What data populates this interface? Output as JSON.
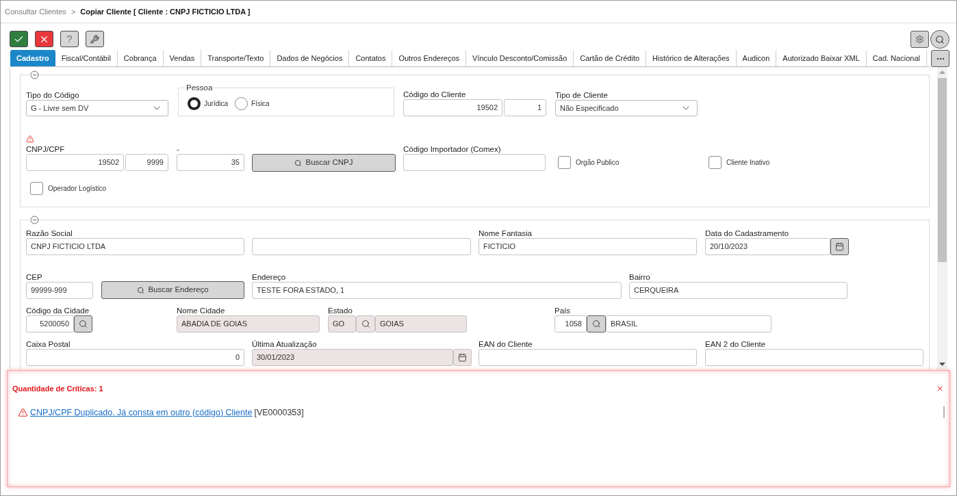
{
  "breadcrumb": {
    "parent": "Consultar Clientes",
    "separator": ">",
    "current": "Copiar Cliente [ Cliente : CNPJ FICTICIO LTDA ]"
  },
  "toolbar": {
    "actions": [
      {
        "kind": "confirm"
      },
      {
        "kind": "cancel"
      },
      {
        "kind": "help",
        "label": "?"
      },
      {
        "kind": "tools"
      }
    ],
    "tools": [
      {
        "kind": "settings"
      },
      {
        "kind": "search"
      }
    ]
  },
  "tabs": [
    {
      "label": "Cadastro",
      "selected": true
    },
    {
      "label": "Fiscal/Contábil",
      "selected": false
    },
    {
      "label": "Cobrança",
      "selected": false
    },
    {
      "label": "Vendas",
      "selected": false
    },
    {
      "label": "Transporte/Texto",
      "selected": false
    },
    {
      "label": "Dados de Negócios",
      "selected": false
    },
    {
      "label": "Contatos",
      "selected": false
    },
    {
      "label": "Outros Endereços",
      "selected": false
    },
    {
      "label": "Vínculo Desconto/Comissão",
      "selected": false
    },
    {
      "label": "Cartão de Crédito",
      "selected": false
    },
    {
      "label": "Histórico de Alterações",
      "selected": false
    },
    {
      "label": "Audicon",
      "selected": false
    },
    {
      "label": "Autorizado Baixar XML",
      "selected": false
    },
    {
      "label": "Cad. Nacional",
      "selected": false
    }
  ],
  "identification": {
    "expanded": true,
    "code_type": {
      "label": "Tipo do Código",
      "value": "G - Livre sem DV"
    },
    "person": {
      "legend": "Pessoa",
      "options": [
        {
          "label": "Jurídica",
          "selected": true
        },
        {
          "label": "Física",
          "selected": false
        }
      ]
    },
    "client_code": {
      "label": "Código do Cliente",
      "values": [
        "19502",
        "1"
      ]
    },
    "client_type": {
      "label": "Tipo de Cliente",
      "value": "Não Especificado"
    },
    "cnpj_cpf": {
      "label": "CNPJ/CPF",
      "warning": true,
      "values": [
        "19502",
        "9999"
      ]
    },
    "check_digit": {
      "label": "-",
      "value": "35"
    },
    "search_cnpj": {
      "label": "Buscar CNPJ"
    },
    "importer_code": {
      "label": "Código Importador (Comex)"
    },
    "flags": [
      {
        "label": "Orgão Publico",
        "checked": false
      },
      {
        "label": "Cliente Inativo",
        "checked": false
      }
    ],
    "logistics_operator": {
      "label": "Operador Logístico",
      "checked": false
    }
  },
  "address": {
    "expanded": true,
    "company_name": {
      "label": "Razão Social",
      "value": "CNPJ FICTICIO LTDA"
    },
    "trade_name": {
      "label": "Nome Fantasia",
      "value": "FICTICIO"
    },
    "registration_date": {
      "label": "Data do Cadastramento",
      "value": "20/10/2023"
    },
    "cep": {
      "label": "CEP",
      "value": "99999-999"
    },
    "search_address": {
      "label": "Buscar Endereço"
    },
    "street": {
      "label": "Endereço",
      "value": "TESTE FORA ESTADO, 1"
    },
    "district": {
      "label": "Bairro",
      "value": "CERQUEIRA"
    },
    "city_code": {
      "label": "Código da Cidade",
      "value": "5200050"
    },
    "city_name": {
      "label": "Nome Cidade",
      "value": "ABADIA DE GOIAS",
      "disabled": true
    },
    "state": {
      "label": "Estado",
      "code": "GO",
      "name": "GOIAS",
      "disabled": true
    },
    "country": {
      "label": "País",
      "code": "1058",
      "name": "BRASIL"
    },
    "po_box": {
      "label": "Caixa Postal",
      "value": "0"
    },
    "last_update": {
      "label": "Última Atualização",
      "value": "30/01/2023",
      "disabled": true
    },
    "ean": {
      "label": "EAN do Cliente"
    },
    "ean_2": {
      "label": "EAN 2 do Cliente"
    }
  },
  "critiques": {
    "title": "Quantidade de Críticas: 1",
    "items": [
      {
        "message": "CNPJ/CPF Duplicado. Já consta em outro (código) Cliente",
        "code": "[VE0000353]"
      }
    ]
  }
}
